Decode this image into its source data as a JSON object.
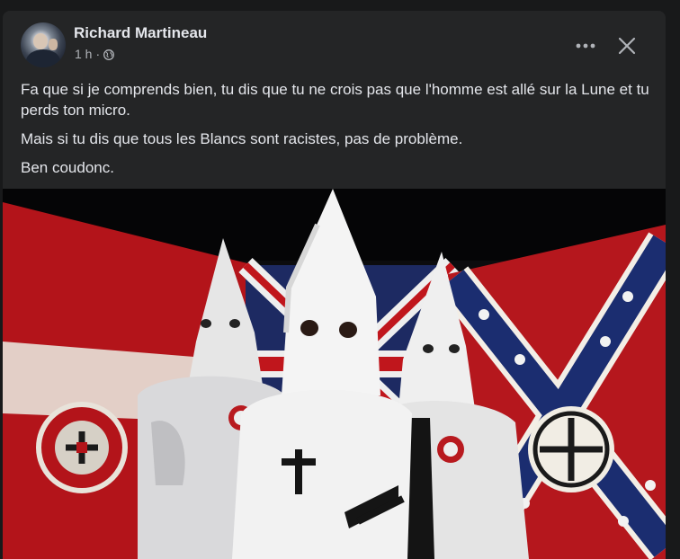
{
  "post": {
    "author": "Richard Martineau",
    "time": "1 h",
    "separator": "·",
    "privacy_icon": "globe-icon",
    "paragraphs": [
      "Fa que si je comprends bien, tu dis que tu ne crois pas que l'homme est allé sur la Lune et tu perds ton micro.",
      "Mais si tu dis que tous les Blancs sont racistes, pas de problème.",
      "Ben coudonc."
    ],
    "photo_subject": "three hooded figures in white robes in front of flags"
  },
  "header": {
    "more_icon": "more-options-icon",
    "close_icon": "close-icon"
  },
  "colors": {
    "card_bg": "#242526",
    "page_bg": "#18191a",
    "primary_text": "#e4e6eb",
    "secondary_text": "#b0b3b8"
  }
}
